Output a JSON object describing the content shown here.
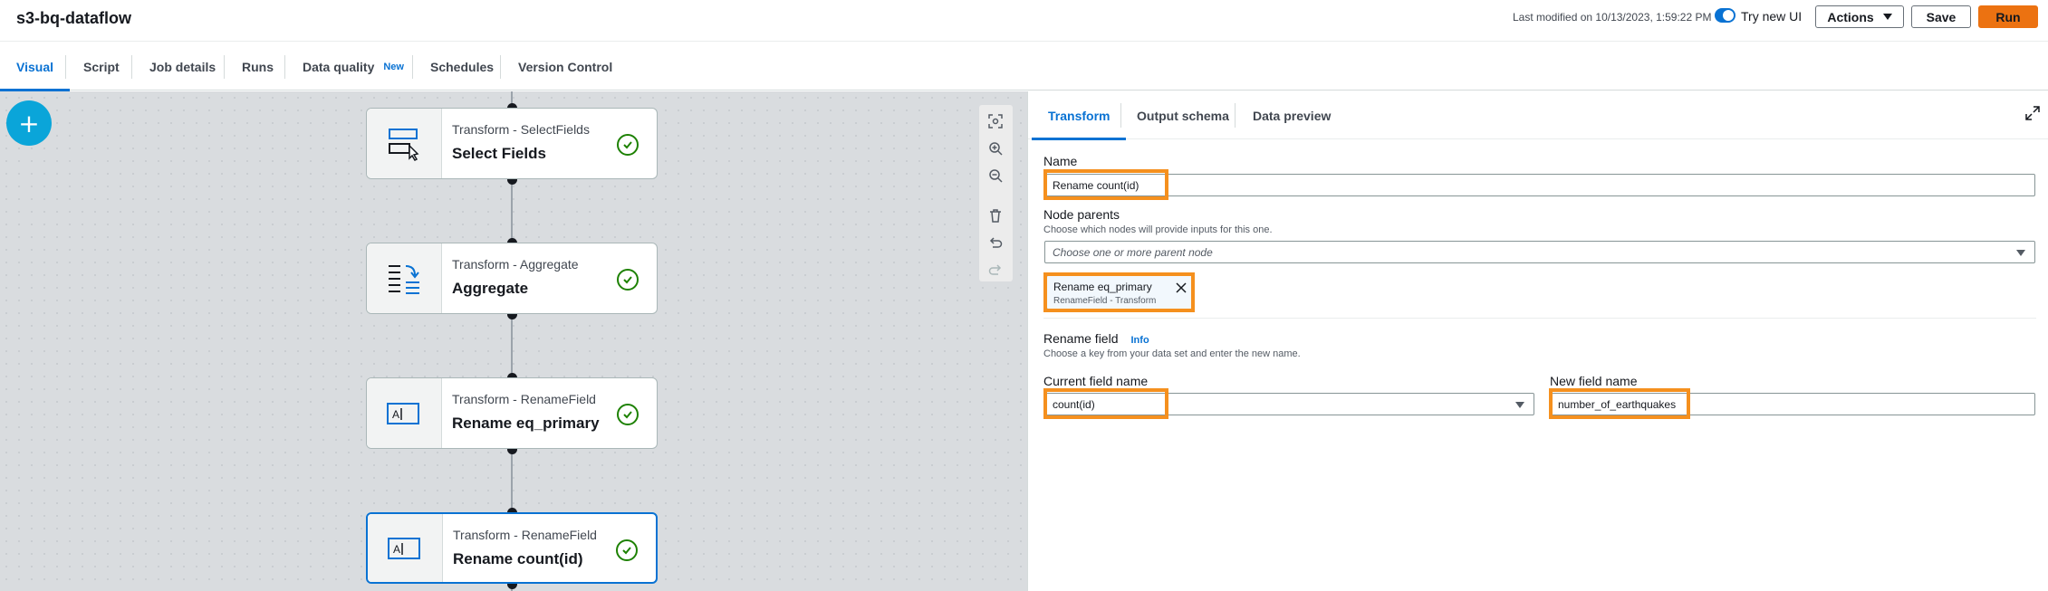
{
  "header": {
    "title": "s3-bq-dataflow",
    "last_modified": "Last modified on 10/13/2023, 1:59:22 PM",
    "try_new_ui": "Try new UI",
    "actions_label": "Actions",
    "save_label": "Save",
    "run_label": "Run"
  },
  "tabs": [
    {
      "label": "Visual",
      "active": true
    },
    {
      "label": "Script"
    },
    {
      "label": "Job details"
    },
    {
      "label": "Runs"
    },
    {
      "label": "Data quality",
      "badge": "New"
    },
    {
      "label": "Schedules"
    },
    {
      "label": "Version Control"
    }
  ],
  "canvas": {
    "add_button": "+",
    "nodes": [
      {
        "type": "Transform - SelectFields",
        "title": "Select Fields",
        "icon": "select-fields-icon",
        "status": "success"
      },
      {
        "type": "Transform - Aggregate",
        "title": "Aggregate",
        "icon": "aggregate-icon",
        "status": "success"
      },
      {
        "type": "Transform - RenameField",
        "title": "Rename eq_primary",
        "icon": "rename-field-icon",
        "status": "success"
      },
      {
        "type": "Transform - RenameField",
        "title": "Rename count(id)",
        "icon": "rename-field-icon",
        "status": "success",
        "selected": true
      }
    ],
    "toolbar_icons": [
      "fit-view-icon",
      "zoom-in-icon",
      "zoom-out-icon",
      "delete-icon",
      "undo-icon",
      "redo-icon"
    ]
  },
  "panel": {
    "tabs": [
      {
        "label": "Transform",
        "active": true
      },
      {
        "label": "Output schema"
      },
      {
        "label": "Data preview"
      }
    ],
    "name_label": "Name",
    "name_value": "Rename count(id)",
    "node_parents_label": "Node parents",
    "node_parents_desc": "Choose which nodes will provide inputs for this one.",
    "node_parents_placeholder": "Choose one or more parent node",
    "parent_token": {
      "title": "Rename eq_primary",
      "subtitle": "RenameField - Transform"
    },
    "rename_field_label": "Rename field",
    "rename_field_info": "Info",
    "rename_field_desc": "Choose a key from your data set and enter the new name.",
    "current_field_label": "Current field name",
    "current_field_value": "count(id)",
    "new_field_label": "New field name",
    "new_field_value": "number_of_earthquakes"
  },
  "colors": {
    "accent": "#0972d3",
    "run_button": "#ec7211",
    "highlight": "#f5901e",
    "success": "#1d8102",
    "add_button": "#0aa5d9"
  }
}
